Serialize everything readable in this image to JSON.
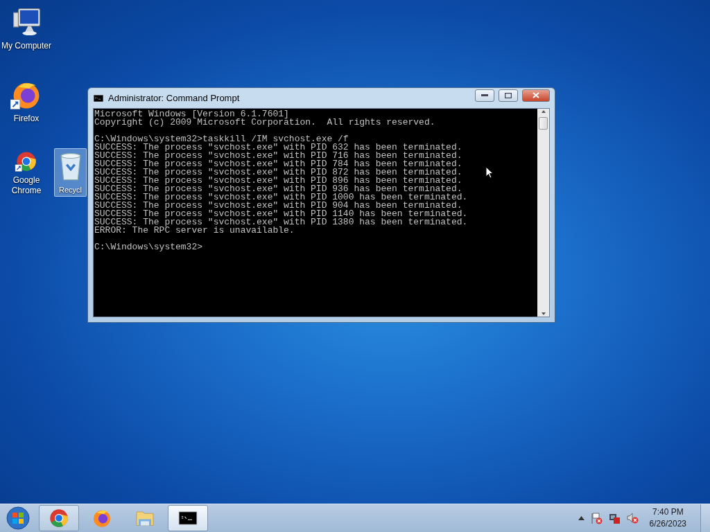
{
  "desktop_icons": [
    {
      "label": "My Computer",
      "kind": "computer",
      "selected": false,
      "shortcut": false
    },
    {
      "label": "Firefox",
      "kind": "firefox",
      "selected": false,
      "shortcut": true
    },
    {
      "label": "Google Chrome",
      "kind": "chrome",
      "selected": false,
      "shortcut": true
    },
    {
      "label": "Recycl",
      "kind": "recycle",
      "selected": true,
      "shortcut": false
    }
  ],
  "window": {
    "title": "Administrator: Command Prompt",
    "blocks": [
      [
        "Microsoft Windows [Version 6.1.7601]",
        "Copyright (c) 2009 Microsoft Corporation.  All rights reserved."
      ],
      [
        "C:\\Windows\\system32>taskkill /IM svchost.exe /f",
        "SUCCESS: The process \"svchost.exe\" with PID 632 has been terminated.",
        "SUCCESS: The process \"svchost.exe\" with PID 716 has been terminated.",
        "SUCCESS: The process \"svchost.exe\" with PID 784 has been terminated.",
        "SUCCESS: The process \"svchost.exe\" with PID 872 has been terminated.",
        "SUCCESS: The process \"svchost.exe\" with PID 896 has been terminated.",
        "SUCCESS: The process \"svchost.exe\" with PID 936 has been terminated.",
        "SUCCESS: The process \"svchost.exe\" with PID 1000 has been terminated.",
        "SUCCESS: The process \"svchost.exe\" with PID 904 has been terminated.",
        "SUCCESS: The process \"svchost.exe\" with PID 1140 has been terminated.",
        "SUCCESS: The process \"svchost.exe\" with PID 1380 has been terminated.",
        "ERROR: The RPC server is unavailable."
      ],
      [
        "C:\\Windows\\system32>"
      ]
    ]
  },
  "taskbar": {
    "apps": [
      {
        "kind": "chrome",
        "selected": false,
        "running": true
      },
      {
        "kind": "firefox",
        "selected": false,
        "running": false
      },
      {
        "kind": "explorer",
        "selected": false,
        "running": false
      },
      {
        "kind": "console",
        "selected": true,
        "running": true
      }
    ],
    "clock": {
      "time": "7:40 PM",
      "date": "6/26/2023"
    }
  }
}
